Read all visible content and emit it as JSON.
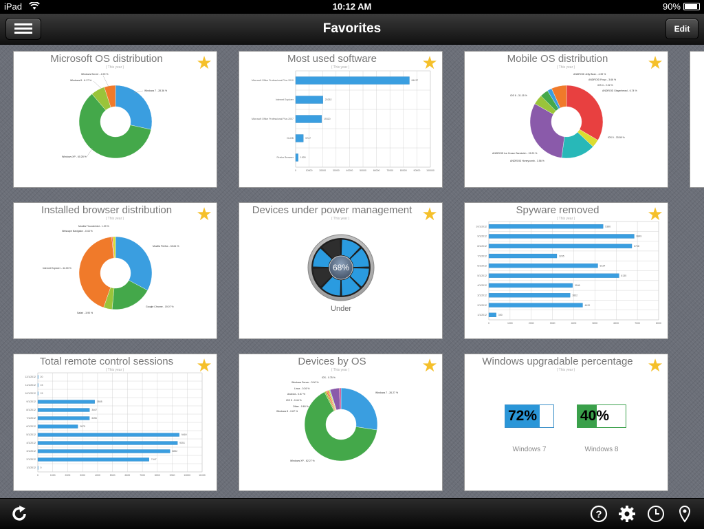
{
  "status": {
    "carrier": "iPad",
    "time": "10:12 AM",
    "battery": "90%"
  },
  "nav": {
    "title": "Favorites",
    "edit_label": "Edit"
  },
  "subtitle": "( This year )",
  "cards": [
    {
      "title": "Microsoft OS distribution"
    },
    {
      "title": "Most used software"
    },
    {
      "title": "Mobile OS distribution"
    },
    {
      "title": "Installed browser distribution"
    },
    {
      "title": "Devices under power management"
    },
    {
      "title": "Spyware removed"
    },
    {
      "title": "Total remote control sessions"
    },
    {
      "title": "Devices by OS"
    },
    {
      "title": "Windows upgradable percentage"
    }
  ],
  "chart_data": [
    {
      "type": "pie",
      "title": "Microsoft OS distribution",
      "subtitle": "( This year )",
      "labels": [
        "Windows 7 - 28.36 %",
        "Windows XP - 60.28 %",
        "Windows 8 - 6.17 %",
        "Windows Server - 4.99 %"
      ],
      "values": [
        28.36,
        60.28,
        6.17,
        4.99
      ],
      "colors": [
        "#3a9ee0",
        "#44a84a",
        "#9ac43a",
        "#f07a2a"
      ]
    },
    {
      "type": "bar",
      "title": "Most used software",
      "subtitle": "( This year )",
      "categories": [
        "Microsoft Office Professional Plus 2010",
        "Internet Explorer",
        "Microsoft Office Professional Plus 2007",
        "GLOB",
        "Firefox Browser"
      ],
      "values": [
        84437,
        20252,
        19320,
        5747,
        1928
      ],
      "xlim": [
        0,
        100000
      ],
      "ticks": [
        "0",
        "10000",
        "20000",
        "30000",
        "40000",
        "50000",
        "60000",
        "70000",
        "80000",
        "90000",
        "100000"
      ]
    },
    {
      "type": "pie",
      "title": "Mobile OS distribution",
      "subtitle": "( This year )",
      "labels": [
        "iOS 5 - 33.55 %",
        "ANDROID Honeycomb - 3.56 %",
        "ANDROID Ice Cream Sandwich - 15.20 %",
        "iOS 6 - 31.15 %",
        "ANDROID Jelly Bean - 4.39 %",
        "ANDROID Froyo - 3.66 %",
        "iOS 4 - 2.02 %",
        "ANDROID Gingerbread - 6.74 %"
      ],
      "values": [
        33.55,
        3.56,
        15.2,
        31.15,
        4.39,
        3.66,
        2.02,
        6.74
      ],
      "colors": [
        "#e84040",
        "#dcdc30",
        "#28b8b8",
        "#8a5aaa",
        "#9ac43a",
        "#44a84a",
        "#3a9ee0",
        "#f07a2a"
      ]
    },
    {
      "type": "pie",
      "title": "Installed browser distribution",
      "subtitle": "( This year )",
      "labels": [
        "Mozilla Firefox - 33.61 %",
        "Google Chrome - 19.07 %",
        "Safari - 3.90 %",
        "Internet Explorer - 44.00 %",
        "Netscape Navigator - 0.43 %",
        "Mozilla Thunderbird - 1.29 %"
      ],
      "values": [
        33.61,
        19.07,
        3.9,
        44.0,
        0.43,
        1.29
      ],
      "colors": [
        "#3a9ee0",
        "#44a84a",
        "#9ac43a",
        "#f07a2a",
        "#e84040",
        "#dcdc30"
      ]
    },
    {
      "type": "gauge",
      "title": "Devices under power management",
      "value": "68%",
      "label": "Under"
    },
    {
      "type": "bar",
      "title": "Spyware removed",
      "subtitle": "( This year )",
      "categories": [
        "10/1/2012",
        "9/1/2012",
        "8/1/2012",
        "7/1/2012",
        "6/1/2012",
        "5/1/2012",
        "4/1/2012",
        "3/1/2012",
        "2/1/2012",
        "1/1/2012"
      ],
      "values": [
        5386,
        6849,
        6738,
        3205,
        5134,
        6135,
        3946,
        3832,
        4420,
        350
      ],
      "xlim": [
        0,
        8000
      ],
      "ticks": [
        "0",
        "1000",
        "2000",
        "3000",
        "4000",
        "5000",
        "6000",
        "7000",
        "8000"
      ]
    },
    {
      "type": "bar",
      "title": "Total remote control sessions",
      "subtitle": "( This year )",
      "categories": [
        "12/1/2012",
        "11/1/2012",
        "10/1/2012",
        "9/1/2012",
        "8/1/2012",
        "7/1/2012",
        "6/1/2012",
        "5/1/2012",
        "4/1/2012",
        "3/1/2012",
        "2/1/2012",
        "1/1/2012"
      ],
      "values": [
        20,
        15,
        15,
        3808,
        3467,
        3456,
        2675,
        9469,
        9351,
        8852,
        7447,
        0
      ],
      "xlim": [
        0,
        11000
      ],
      "ticks": [
        "0",
        "1000",
        "2000",
        "3000",
        "4000",
        "5000",
        "6000",
        "7000",
        "8000",
        "9000",
        "10000",
        "11000"
      ]
    },
    {
      "type": "pie",
      "title": "Devices by OS",
      "subtitle": "( This year )",
      "labels": [
        "Windows 7 - 26.27 %",
        "Windows XP - 62.27 %",
        "Windows 8 - 0.67 %",
        "Other - 0.60 %",
        "iOS 5 - 0.44 %",
        "Android - 0.57 %",
        "Linux - 0.26 %",
        "Windows Server - 3.90 %",
        "iOS - 0.75 %"
      ],
      "values": [
        26.27,
        62.27,
        0.67,
        0.6,
        0.44,
        0.57,
        0.26,
        3.9,
        0.75
      ],
      "colors": [
        "#3a9ee0",
        "#44a84a",
        "#9ac43a",
        "#f07a2a",
        "#e84040",
        "#dcdc30",
        "#28b8b8",
        "#8a5aaa",
        "#c84a8a"
      ]
    },
    {
      "type": "percent",
      "title": "Windows upgradable percentage",
      "subtitle": "( This year )",
      "items": [
        {
          "label": "Windows 7",
          "value": 72,
          "text": "72%",
          "color": "#2a96d8"
        },
        {
          "label": "Windows 8",
          "value": 40,
          "text": "40%",
          "color": "#3aa04a"
        }
      ]
    }
  ],
  "icons": {
    "menu": "menu-icon",
    "refresh": "refresh-icon",
    "help": "help-icon",
    "settings": "gear-icon",
    "clock": "clock-icon",
    "location": "location-pin-icon",
    "star": "star-icon"
  }
}
